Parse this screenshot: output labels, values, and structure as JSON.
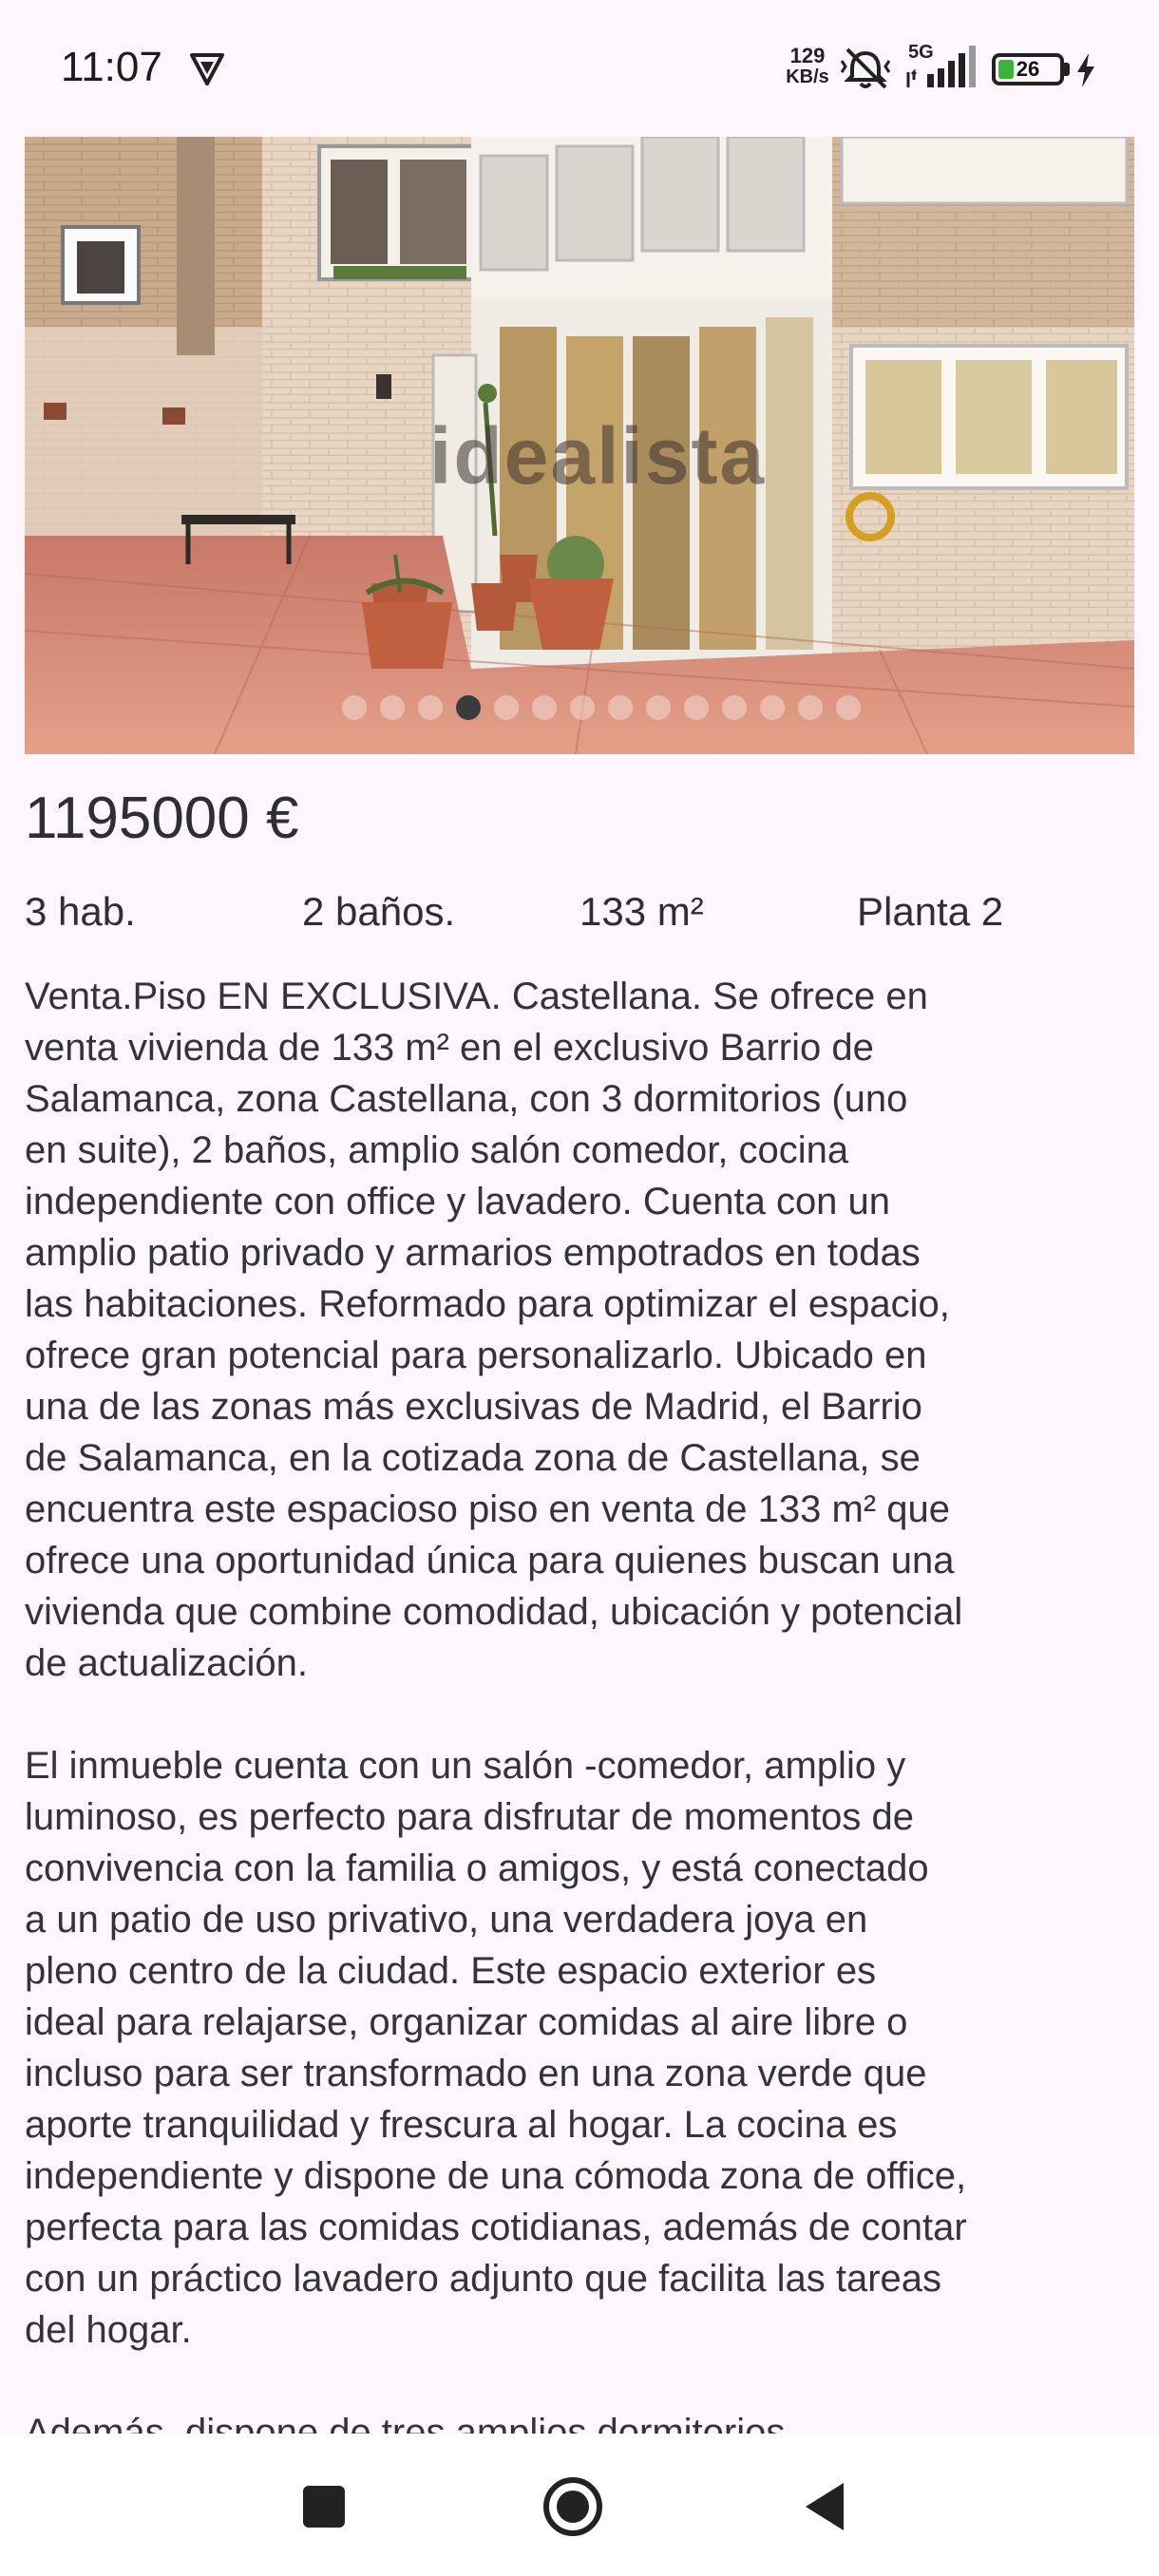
{
  "status_bar": {
    "time": "11:07",
    "net_speed_value": "129",
    "net_speed_unit": "KB/s",
    "network_type": "5G",
    "battery_level": "26",
    "battery_fraction": 0.26,
    "icons": [
      "vpn-icon",
      "mute-vibrate-icon",
      "signal-icon",
      "battery-icon",
      "charging-bolt-icon"
    ]
  },
  "gallery": {
    "watermark": "idealista",
    "image_count": 14,
    "active_index": 3
  },
  "listing": {
    "price": "1195000 €",
    "features": [
      "3 hab.",
      "2 baños.",
      "133 m²",
      "Planta 2"
    ],
    "description": [
      "Venta.Piso EN EXCLUSIVA. Castellana. Se ofrece en\nventa vivienda de 133 m² en el exclusivo Barrio de\nSalamanca, zona Castellana, con 3 dormitorios (uno\nen suite), 2 baños, amplio salón comedor, cocina\nindependiente con office y lavadero. Cuenta con un\namplio patio privado y armarios empotrados en todas\nlas habitaciones. Reformado para optimizar el espacio,\nofrece gran potencial para personalizarlo. Ubicado en\nuna de las zonas más exclusivas de Madrid, el Barrio\nde Salamanca, en la cotizada zona de Castellana, se\nencuentra este espacioso piso en venta de 133 m² que\nofrece una oportunidad única para quienes buscan una\nvivienda que combine comodidad, ubicación y potencial\nde actualización.",
      "El inmueble cuenta con un salón -comedor, amplio y\nluminoso, es perfecto para disfrutar de momentos de\nconvivencia con la familia o amigos, y está conectado\na un patio de uso privativo, una verdadera joya en\npleno centro de la ciudad. Este espacio exterior es\nideal para relajarse, organizar comidas al aire libre o\nincluso para ser transformado en una zona verde que\naporte tranquilidad y frescura al hogar. La cocina es\nindependiente y dispone de una cómoda zona de office,\nperfecta para las comidas cotidianas, además de contar\ncon un práctico lavadero adjunto que facilita las tareas\ndel hogar."
    ],
    "truncated_line": "Además, dispone de tres amplios dormitorios"
  },
  "nav_bar": {
    "buttons": [
      "recents-button",
      "home-button",
      "back-button"
    ]
  }
}
